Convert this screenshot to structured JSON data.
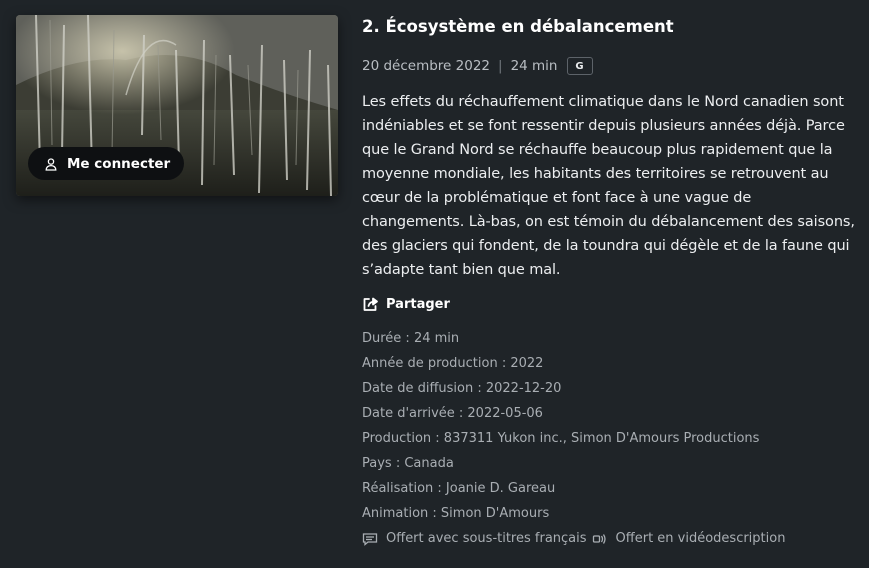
{
  "thumbnail": {
    "connect_label": "Me connecter",
    "connect_icon": "user-icon"
  },
  "episode": {
    "title": "2. Écosystème en débalancement",
    "date": "20 décembre 2022",
    "separator": "|",
    "duration": "24 min",
    "rating": "G",
    "description": "Les effets du réchauffement climatique dans le Nord canadien sont indéniables et se font ressentir depuis plusieurs années déjà. Parce que le Grand Nord se réchauffe beaucoup plus rapidement que la moyenne mondiale, les habitants des territoires se retrouvent au cœur de la problématique et font face à une vague de changements. Là-bas, on est témoin du débalancement des saisons, des glaciers qui fondent, de la toundra qui dégèle et de la faune qui s’adapte tant bien que mal."
  },
  "share": {
    "label": "Partager",
    "icon": "share-icon"
  },
  "facts": [
    "Durée : 24 min",
    "Année de production : 2022",
    "Date de diffusion : 2022-12-20",
    "Date d'arrivée : 2022-05-06",
    "Production : 837311 Yukon inc., Simon D'Amours Productions",
    "Pays : Canada",
    "Réalisation : Joanie D. Gareau",
    "Animation : Simon D'Amours"
  ],
  "offers": {
    "subtitles": "Offert avec sous-titres français",
    "subtitles_icon": "subtitles-icon",
    "audio_description": "Offert en vidéodescription",
    "audio_description_icon": "audio-description-icon"
  },
  "colors": {
    "background": "#1f2428",
    "text_primary": "#ffffff",
    "text_secondary": "#a9aeb3",
    "button_bg": "#0e1012"
  }
}
